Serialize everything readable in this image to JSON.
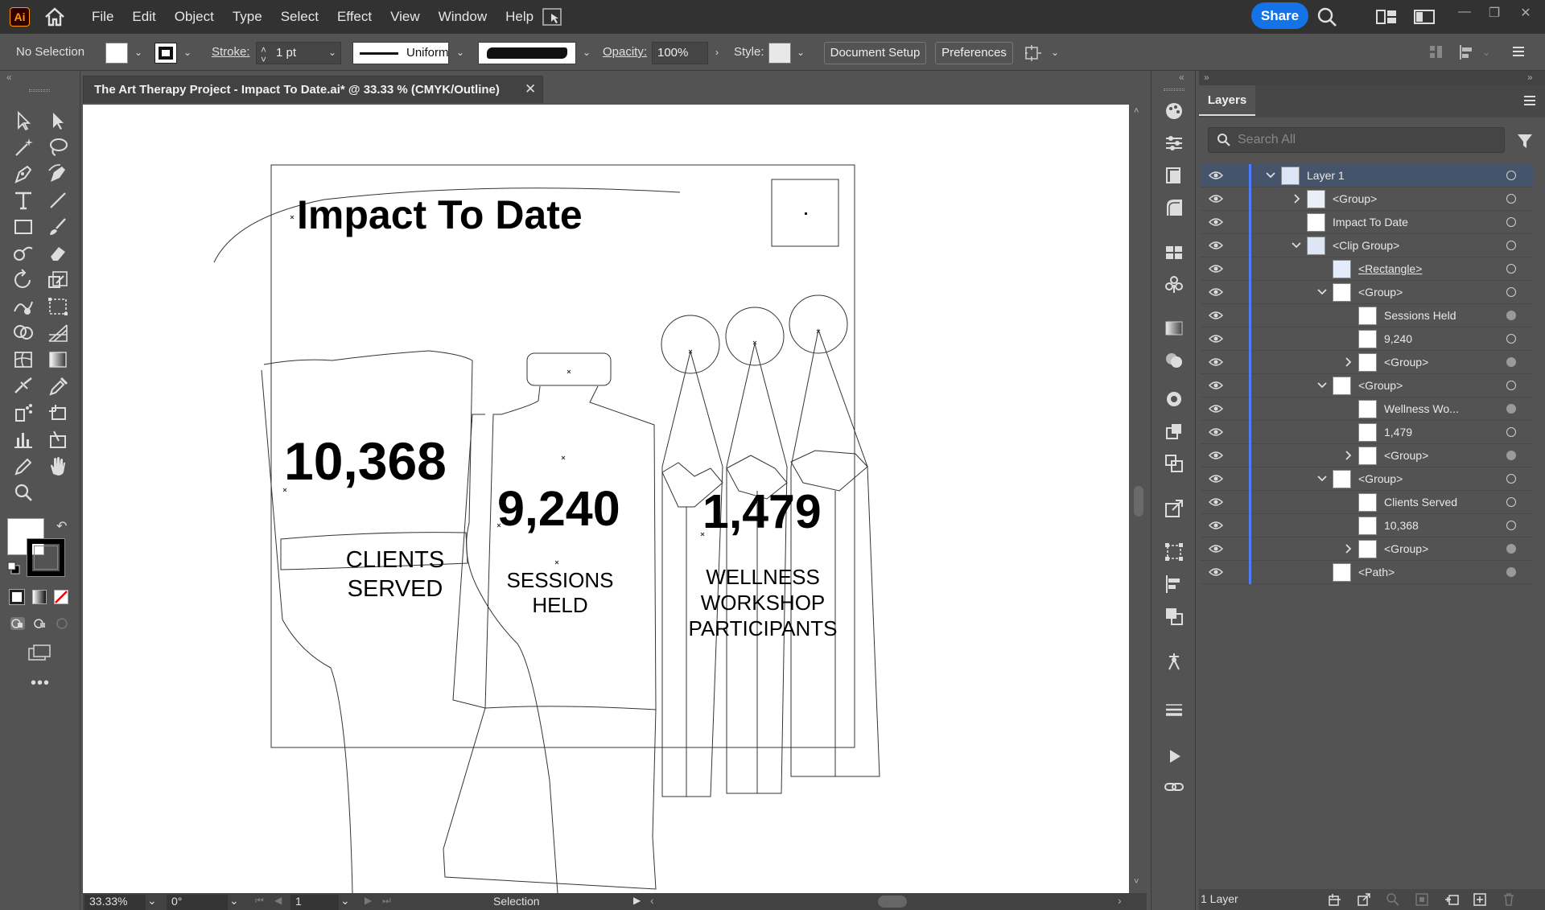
{
  "app": {
    "logo_text": "Ai",
    "menu": [
      "File",
      "Edit",
      "Object",
      "Type",
      "Select",
      "Effect",
      "View",
      "Window",
      "Help"
    ],
    "share_label": "Share",
    "accent": "#1473e6"
  },
  "control_bar": {
    "selection_status": "No Selection",
    "stroke_label": "Stroke:",
    "stroke_weight": "1 pt",
    "stroke_profile": "Uniform",
    "opacity_label": "Opacity:",
    "opacity_value": "100%",
    "style_label": "Style:",
    "document_setup_label": "Document Setup",
    "preferences_label": "Preferences"
  },
  "document": {
    "tab_title": "The Art Therapy Project - Impact To Date.ai* @ 33.33 % (CMYK/Outline)",
    "close_glyph": "✕"
  },
  "artwork": {
    "heading": "Impact To Date",
    "stat1_value": "10,368",
    "stat1_line1": "CLIENTS",
    "stat1_line2": "SERVED",
    "stat2_value": "9,240",
    "stat2_line1": "SESSIONS",
    "stat2_line2": "HELD",
    "stat3_value": "1,479",
    "stat3_line1": "WELLNESS",
    "stat3_line2": "WORKSHOP",
    "stat3_line3": "PARTICIPANTS"
  },
  "status_bar": {
    "zoom": "33.33%",
    "rotation": "0°",
    "artboard": "1",
    "current_tool": "Selection"
  },
  "layers_panel": {
    "tab_label": "Layers",
    "search_placeholder": "Search All",
    "rows": [
      {
        "name": "Layer 1",
        "chevron": "down",
        "selected": true,
        "target": "empty"
      },
      {
        "name": "<Group>",
        "chevron": "right",
        "target": "empty"
      },
      {
        "name": "Impact To Date",
        "chevron": "none",
        "target": "empty"
      },
      {
        "name": "<Clip Group>",
        "chevron": "down",
        "target": "empty"
      },
      {
        "name": "<Rectangle>",
        "chevron": "none",
        "target": "empty",
        "underline": true
      },
      {
        "name": "<Group>",
        "chevron": "down",
        "target": "empty"
      },
      {
        "name": "Sessions Held",
        "chevron": "none",
        "target": "filled"
      },
      {
        "name": "9,240",
        "chevron": "none",
        "target": "empty"
      },
      {
        "name": "<Group>",
        "chevron": "right",
        "target": "filled"
      },
      {
        "name": "<Group>",
        "chevron": "down",
        "target": "empty"
      },
      {
        "name": "Wellness Wo...",
        "chevron": "none",
        "target": "filled"
      },
      {
        "name": "1,479",
        "chevron": "none",
        "target": "empty"
      },
      {
        "name": "<Group>",
        "chevron": "right",
        "target": "filled"
      },
      {
        "name": "<Group>",
        "chevron": "down",
        "target": "empty"
      },
      {
        "name": "Clients Served",
        "chevron": "none",
        "target": "empty"
      },
      {
        "name": "10,368",
        "chevron": "none",
        "target": "empty"
      },
      {
        "name": "<Group>",
        "chevron": "right",
        "target": "filled"
      },
      {
        "name": "<Path>",
        "chevron": "none",
        "target": "filled"
      }
    ],
    "layer_count": "1 Layer"
  }
}
